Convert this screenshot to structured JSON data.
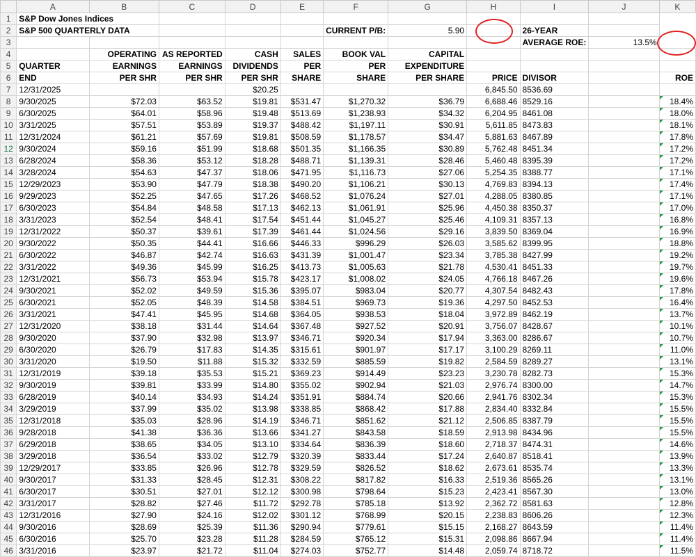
{
  "columns": [
    "A",
    "B",
    "C",
    "D",
    "E",
    "F",
    "G",
    "H",
    "I",
    "J",
    "K"
  ],
  "cells": {
    "title1": "S&P Dow Jones Indices",
    "title2": "S&P 500 QUARTERLY DATA",
    "current_pb_label": "CURRENT P/B:",
    "current_pb_value": "5.90",
    "roe_label_1": "26-YEAR",
    "roe_label_2": "AVERAGE ROE:",
    "roe_value": "13.5%",
    "h4": {
      "B": "OPERATING",
      "C": "AS REPORTED",
      "D": "CASH",
      "E": "SALES",
      "F": "BOOK VAL",
      "G": "CAPITAL"
    },
    "h5": {
      "A": "QUARTER",
      "B": "EARNINGS",
      "C": "EARNINGS",
      "D": "DIVIDENDS",
      "E": "PER",
      "F": "PER",
      "G": "EXPENDITURE"
    },
    "h6": {
      "A": "END",
      "B": "PER SHR",
      "C": "PER SHR",
      "D": "PER SHR",
      "E": "SHARE",
      "F": "SHARE",
      "G": "PER SHARE",
      "H": "PRICE",
      "I": "DIVISOR",
      "K": "ROE"
    }
  },
  "rows": [
    [
      "12/31/2025",
      "",
      "",
      "$20.25",
      "",
      "",
      "",
      "6,845.50",
      "8536.69",
      ""
    ],
    [
      "9/30/2025",
      "$72.03",
      "$63.52",
      "$19.81",
      "$531.47",
      "$1,270.32",
      "$36.79",
      "6,688.46",
      "8529.16",
      "18.4%"
    ],
    [
      "6/30/2025",
      "$64.01",
      "$58.96",
      "$19.48",
      "$513.69",
      "$1,238.93",
      "$34.32",
      "6,204.95",
      "8461.08",
      "18.0%"
    ],
    [
      "3/31/2025",
      "$57.51",
      "$53.89",
      "$19.37",
      "$488.42",
      "$1,197.11",
      "$30.91",
      "5,611.85",
      "8473.83",
      "18.1%"
    ],
    [
      "12/31/2024",
      "$61.21",
      "$57.69",
      "$19.81",
      "$508.59",
      "$1,178.57",
      "$34.47",
      "5,881.63",
      "8467.89",
      "17.8%"
    ],
    [
      "9/30/2024",
      "$59.16",
      "$51.99",
      "$18.68",
      "$501.35",
      "$1,166.35",
      "$30.89",
      "5,762.48",
      "8451.34",
      "17.2%"
    ],
    [
      "6/28/2024",
      "$58.36",
      "$53.12",
      "$18.28",
      "$488.71",
      "$1,139.31",
      "$28.46",
      "5,460.48",
      "8395.39",
      "17.2%"
    ],
    [
      "3/28/2024",
      "$54.63",
      "$47.37",
      "$18.06",
      "$471.95",
      "$1,116.73",
      "$27.06",
      "5,254.35",
      "8388.77",
      "17.1%"
    ],
    [
      "12/29/2023",
      "$53.90",
      "$47.79",
      "$18.38",
      "$490.20",
      "$1,106.21",
      "$30.13",
      "4,769.83",
      "8394.13",
      "17.4%"
    ],
    [
      "9/29/2023",
      "$52.25",
      "$47.65",
      "$17.26",
      "$468.52",
      "$1,076.24",
      "$27.01",
      "4,288.05",
      "8380.85",
      "17.1%"
    ],
    [
      "6/30/2023",
      "$54.84",
      "$48.58",
      "$17.13",
      "$462.13",
      "$1,061.91",
      "$25.96",
      "4,450.38",
      "8350.37",
      "17.0%"
    ],
    [
      "3/31/2023",
      "$52.54",
      "$48.41",
      "$17.54",
      "$451.44",
      "$1,045.27",
      "$25.46",
      "4,109.31",
      "8357.13",
      "16.8%"
    ],
    [
      "12/31/2022",
      "$50.37",
      "$39.61",
      "$17.39",
      "$461.44",
      "$1,024.56",
      "$29.16",
      "3,839.50",
      "8369.04",
      "16.9%"
    ],
    [
      "9/30/2022",
      "$50.35",
      "$44.41",
      "$16.66",
      "$446.33",
      "$996.29",
      "$26.03",
      "3,585.62",
      "8399.95",
      "18.8%"
    ],
    [
      "6/30/2022",
      "$46.87",
      "$42.74",
      "$16.63",
      "$431.39",
      "$1,001.47",
      "$23.34",
      "3,785.38",
      "8427.99",
      "19.2%"
    ],
    [
      "3/31/2022",
      "$49.36",
      "$45.99",
      "$16.25",
      "$413.73",
      "$1,005.63",
      "$21.78",
      "4,530.41",
      "8451.33",
      "19.7%"
    ],
    [
      "12/31/2021",
      "$56.73",
      "$53.94",
      "$15.78",
      "$423.17",
      "$1,008.02",
      "$24.05",
      "4,766.18",
      "8467.26",
      "19.6%"
    ],
    [
      "9/30/2021",
      "$52.02",
      "$49.59",
      "$15.36",
      "$395.07",
      "$983.04",
      "$20.77",
      "4,307.54",
      "8482.43",
      "17.8%"
    ],
    [
      "6/30/2021",
      "$52.05",
      "$48.39",
      "$14.58",
      "$384.51",
      "$969.73",
      "$19.36",
      "4,297.50",
      "8452.53",
      "16.4%"
    ],
    [
      "3/31/2021",
      "$47.41",
      "$45.95",
      "$14.68",
      "$364.05",
      "$938.53",
      "$18.04",
      "3,972.89",
      "8462.19",
      "13.7%"
    ],
    [
      "12/31/2020",
      "$38.18",
      "$31.44",
      "$14.64",
      "$367.48",
      "$927.52",
      "$20.91",
      "3,756.07",
      "8428.67",
      "10.1%"
    ],
    [
      "9/30/2020",
      "$37.90",
      "$32.98",
      "$13.97",
      "$346.71",
      "$920.34",
      "$17.94",
      "3,363.00",
      "8286.67",
      "10.7%"
    ],
    [
      "6/30/2020",
      "$26.79",
      "$17.83",
      "$14.35",
      "$315.61",
      "$901.97",
      "$17.17",
      "3,100.29",
      "8269.11",
      "11.0%"
    ],
    [
      "3/31/2020",
      "$19.50",
      "$11.88",
      "$15.32",
      "$332.59",
      "$885.59",
      "$19.82",
      "2,584.59",
      "8289.27",
      "13.1%"
    ],
    [
      "12/31/2019",
      "$39.18",
      "$35.53",
      "$15.21",
      "$369.23",
      "$914.49",
      "$23.23",
      "3,230.78",
      "8282.73",
      "15.3%"
    ],
    [
      "9/30/2019",
      "$39.81",
      "$33.99",
      "$14.80",
      "$355.02",
      "$902.94",
      "$21.03",
      "2,976.74",
      "8300.00",
      "14.7%"
    ],
    [
      "6/28/2019",
      "$40.14",
      "$34.93",
      "$14.24",
      "$351.91",
      "$884.74",
      "$20.66",
      "2,941.76",
      "8302.34",
      "15.3%"
    ],
    [
      "3/29/2019",
      "$37.99",
      "$35.02",
      "$13.98",
      "$338.85",
      "$868.42",
      "$17.88",
      "2,834.40",
      "8332.84",
      "15.5%"
    ],
    [
      "12/31/2018",
      "$35.03",
      "$28.96",
      "$14.19",
      "$346.71",
      "$851.62",
      "$21.12",
      "2,506.85",
      "8387.79",
      "15.5%"
    ],
    [
      "9/28/2018",
      "$41.38",
      "$36.36",
      "$13.66",
      "$341.27",
      "$843.58",
      "$18.59",
      "2,913.98",
      "8434.96",
      "15.5%"
    ],
    [
      "6/29/2018",
      "$38.65",
      "$34.05",
      "$13.10",
      "$334.64",
      "$836.39",
      "$18.60",
      "2,718.37",
      "8474.31",
      "14.6%"
    ],
    [
      "3/29/2018",
      "$36.54",
      "$33.02",
      "$12.79",
      "$320.39",
      "$833.44",
      "$17.24",
      "2,640.87",
      "8518.41",
      "13.9%"
    ],
    [
      "12/29/2017",
      "$33.85",
      "$26.96",
      "$12.78",
      "$329.59",
      "$826.52",
      "$18.62",
      "2,673.61",
      "8535.74",
      "13.3%"
    ],
    [
      "9/30/2017",
      "$31.33",
      "$28.45",
      "$12.31",
      "$308.22",
      "$817.82",
      "$16.33",
      "2,519.36",
      "8565.26",
      "13.1%"
    ],
    [
      "6/30/2017",
      "$30.51",
      "$27.01",
      "$12.12",
      "$300.98",
      "$798.64",
      "$15.23",
      "2,423.41",
      "8567.30",
      "13.0%"
    ],
    [
      "3/31/2017",
      "$28.82",
      "$27.46",
      "$11.72",
      "$292.78",
      "$785.18",
      "$13.92",
      "2,362.72",
      "8581.63",
      "12.8%"
    ],
    [
      "12/31/2016",
      "$27.90",
      "$24.16",
      "$12.02",
      "$301.12",
      "$768.99",
      "$20.15",
      "2,238.83",
      "8606.26",
      "12.3%"
    ],
    [
      "9/30/2016",
      "$28.69",
      "$25.39",
      "$11.36",
      "$290.94",
      "$779.61",
      "$15.15",
      "2,168.27",
      "8643.59",
      "11.4%"
    ],
    [
      "6/30/2016",
      "$25.70",
      "$23.28",
      "$11.28",
      "$284.59",
      "$765.12",
      "$15.31",
      "2,098.86",
      "8667.94",
      "11.4%"
    ],
    [
      "3/31/2016",
      "$23.97",
      "$21.72",
      "$11.04",
      "$274.03",
      "$752.77",
      "$14.48",
      "2,059.74",
      "8718.72",
      "11.5%"
    ]
  ]
}
